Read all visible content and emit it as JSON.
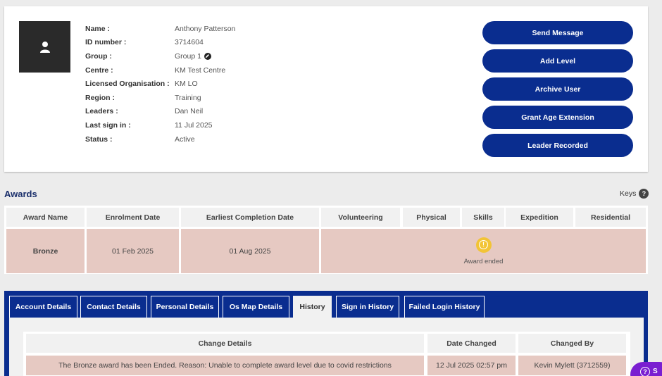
{
  "profile": {
    "fields": [
      {
        "label": "Name :",
        "value": "Anthony Patterson"
      },
      {
        "label": "ID number :",
        "value": "3714604"
      },
      {
        "label": "Group :",
        "value": "Group 1"
      },
      {
        "label": "Centre :",
        "value": "KM Test Centre"
      },
      {
        "label": "Licensed Organisation :",
        "value": "KM LO"
      },
      {
        "label": "Region :",
        "value": "Training"
      },
      {
        "label": "Leaders :",
        "value": "Dan Neil"
      },
      {
        "label": "Last sign in :",
        "value": "11 Jul 2025"
      },
      {
        "label": "Status :",
        "value": "Active"
      }
    ],
    "actions": [
      "Send Message",
      "Add Level",
      "Archive User",
      "Grant Age Extension",
      "Leader Recorded"
    ]
  },
  "awards": {
    "title": "Awards",
    "keys_label": "Keys",
    "keys_icon": "?",
    "headers": [
      "Award Name",
      "Enrolment Date",
      "Earliest Completion Date",
      "Volunteering",
      "Physical",
      "Skills",
      "Expedition",
      "Residential"
    ],
    "row": {
      "award_name": "Bronze",
      "enrolment_date": "01 Feb 2025",
      "earliest_completion": "01 Aug 2025",
      "status_text": "Award ended",
      "status_icon": "!"
    }
  },
  "tabs": [
    "Account Details",
    "Contact Details",
    "Personal Details",
    "Os Map Details",
    "History",
    "Sign in History",
    "Failed Login History"
  ],
  "active_tab": "History",
  "history": {
    "headers": [
      "Change Details",
      "Date Changed",
      "Changed By"
    ],
    "rows": [
      [
        "The Bronze award has been Ended. Reason: Unable to complete award level due to covid restrictions",
        "12 Jul 2025 02:57 pm",
        "Kevin Mylett (3712559)"
      ]
    ]
  },
  "help": {
    "icon": "?",
    "label": "S"
  },
  "colors": {
    "primary": "#0a2d8f",
    "row_highlight": "#e6c9c2",
    "warning": "#f2c436",
    "help": "#7a1fd1"
  }
}
